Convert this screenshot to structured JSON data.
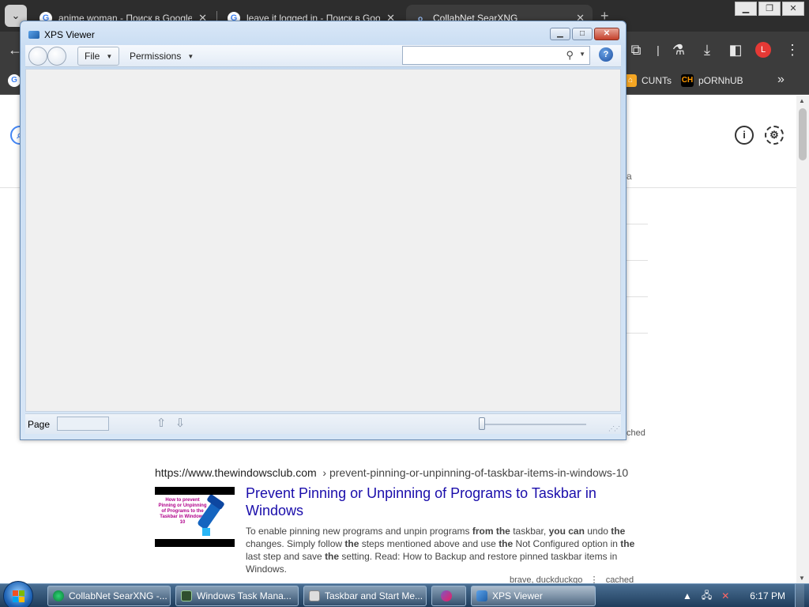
{
  "chrome": {
    "tabs": [
      {
        "title": "anime woman - Поиск в Google"
      },
      {
        "title": "leave it logged in - Поиск в Google"
      },
      {
        "title": "CollabNet SearXNG"
      }
    ],
    "bookmarks": [
      {
        "label": "CUNTs"
      },
      {
        "label": "pORNhUB"
      }
    ],
    "profile_initial": "L"
  },
  "page": {
    "fragment_a": "a",
    "fragment_ched": "ched",
    "result": {
      "url": "https://www.thewindowsclub.com",
      "breadcrumb": "› prevent-pinning-or-unpinning-of-taskbar-items-in-windows-10",
      "title": "Prevent Pinning or Unpinning of Programs to Taskbar in Windows",
      "thumbnail_text": "How to prevent Pinning or Unpinning of Programs to the Taskbar in Windows 10",
      "snippet": [
        {
          "t": "To enable pinning new programs and unpin programs ",
          "b": false
        },
        {
          "t": "from the",
          "b": true
        },
        {
          "t": " taskbar, ",
          "b": false
        },
        {
          "t": "you can",
          "b": true
        },
        {
          "t": " undo ",
          "b": false
        },
        {
          "t": "the",
          "b": true
        },
        {
          "t": " changes. Simply follow ",
          "b": false
        },
        {
          "t": "the",
          "b": true
        },
        {
          "t": " steps mentioned above and use ",
          "b": false
        },
        {
          "t": "the",
          "b": true
        },
        {
          "t": " Not Configured option in ",
          "b": false
        },
        {
          "t": "the",
          "b": true
        },
        {
          "t": " last step and save ",
          "b": false
        },
        {
          "t": "the",
          "b": true
        },
        {
          "t": " setting. Read: How to Backup and restore pinned taskbar items in Windows.",
          "b": false
        }
      ],
      "engines": "brave, duckduckgo",
      "cached": "cached"
    }
  },
  "xps": {
    "title": "XPS Viewer",
    "menu_file": "File",
    "menu_permissions": "Permissions",
    "search_value": "",
    "page_label": "Page",
    "page_value": "",
    "zoom_level": 0
  },
  "taskbar": {
    "buttons": [
      {
        "label": "CollabNet SearXNG -..."
      },
      {
        "label": "Windows Task Mana..."
      },
      {
        "label": "Taskbar and Start Me..."
      },
      {
        "label": ""
      },
      {
        "label": "XPS Viewer"
      }
    ],
    "clock": "6:17 PM"
  }
}
